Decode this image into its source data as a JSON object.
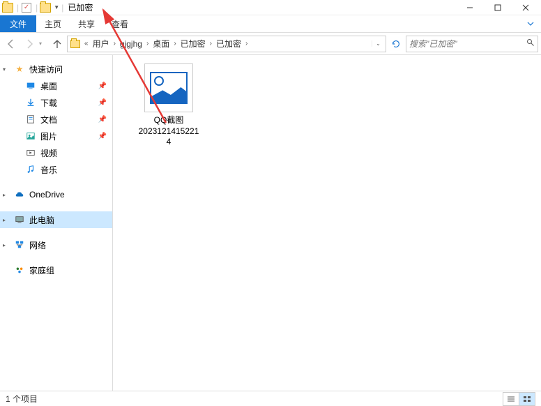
{
  "titlebar": {
    "title": "已加密"
  },
  "ribbon": {
    "file": "文件",
    "tabs": [
      "主页",
      "共享",
      "查看"
    ]
  },
  "navbar": {
    "chev_left": "«",
    "crumbs": [
      "用户",
      "gjgjhg",
      "桌面",
      "已加密",
      "已加密"
    ]
  },
  "search": {
    "placeholder": "搜索\"已加密\""
  },
  "sidebar": {
    "quick": "快速访问",
    "items": [
      {
        "label": "桌面",
        "pin": true
      },
      {
        "label": "下载",
        "pin": true
      },
      {
        "label": "文档",
        "pin": true
      },
      {
        "label": "图片",
        "pin": true
      },
      {
        "label": "视频",
        "pin": false
      },
      {
        "label": "音乐",
        "pin": false
      }
    ],
    "onedrive": "OneDrive",
    "thispc": "此电脑",
    "network": "网络",
    "homegroup": "家庭组"
  },
  "file": {
    "name_l1": "QQ截图",
    "name_l2": "2023121415221",
    "name_l3": "4"
  },
  "status": {
    "count": "1 个项目"
  }
}
